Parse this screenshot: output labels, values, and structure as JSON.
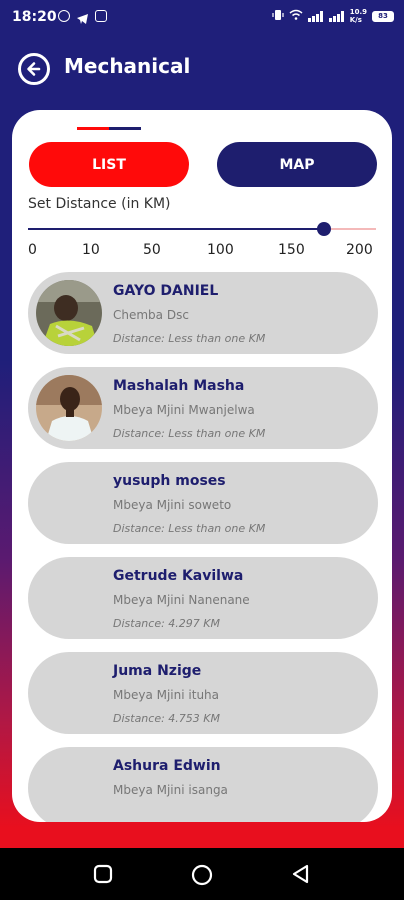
{
  "status_bar": {
    "time": "18:20",
    "net_speed_line1": "10.9",
    "net_speed_line2": "K/s",
    "battery": "83"
  },
  "header": {
    "title": "Mechanical",
    "back_icon": "arrow-left-circle-icon"
  },
  "tabs": {
    "list_label": "LIST",
    "map_label": "MAP",
    "active": "LIST"
  },
  "distance_filter": {
    "label": "Set Distance (in KM)",
    "ticks": [
      "0",
      "10",
      "50",
      "100",
      "150",
      "200"
    ],
    "value_fraction": 0.85
  },
  "colors": {
    "navy": "#1e1e6e",
    "red": "#ff0a0a",
    "card_item_bg": "#d6d6d6"
  },
  "mechanics": [
    {
      "name": "GAYO DANIEL",
      "location": "Chemba Dsc",
      "distance": "Distance: Less than one KM",
      "has_photo": true
    },
    {
      "name": "Mashalah Masha",
      "location": "Mbeya Mjini Mwanjelwa",
      "distance": "Distance: Less than one KM",
      "has_photo": true
    },
    {
      "name": "yusuph moses",
      "location": "Mbeya Mjini soweto",
      "distance": "Distance: Less than one KM",
      "has_photo": false
    },
    {
      "name": "Getrude Kavilwa",
      "location": "Mbeya Mjini Nanenane",
      "distance": "Distance: 4.297 KM",
      "has_photo": false
    },
    {
      "name": "Juma Nzige",
      "location": "Mbeya Mjini ituha",
      "distance": "Distance: 4.753 KM",
      "has_photo": false
    },
    {
      "name": "Ashura Edwin",
      "location": "Mbeya Mjini isanga",
      "distance": "",
      "has_photo": false
    }
  ],
  "nav": {
    "icons": [
      "recent-apps-icon",
      "home-icon",
      "back-icon"
    ]
  }
}
